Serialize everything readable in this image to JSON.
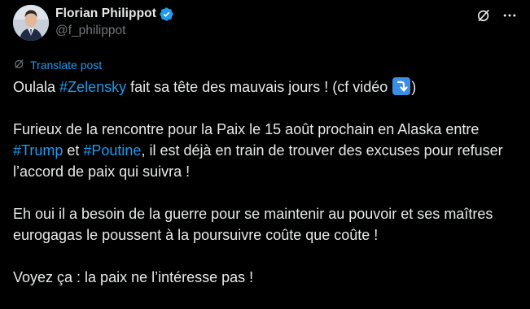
{
  "author": {
    "display_name": "Florian Philippot",
    "handle": "@f_philippot"
  },
  "icons": {
    "verified": "verified-badge-icon",
    "grok": "grok-icon",
    "more": "more-options-icon",
    "translate": "translate-icon",
    "arrow_emoji": "right-arrow-curving-down-icon"
  },
  "colors": {
    "background": "#000000",
    "text": "#e7e9ea",
    "secondary_text": "#71767b",
    "accent": "#1d9bf0"
  },
  "translate_label": "Translate post",
  "post": {
    "p1": {
      "before": "Oulala ",
      "hashtag": "#Zelensky",
      "after": " fait sa tête des mauvais jours ! (cf vidéo ",
      "end": ")"
    },
    "p2": {
      "before": "Furieux de la rencontre pour la Paix le 15 août prochain en Alaska entre ",
      "hashtag1": "#Trump",
      "middle": " et ",
      "hashtag2": "#Poutine",
      "after": ", il est déjà en train de trouver des excuses pour refuser l’accord de paix qui suivra !"
    },
    "p3": "Eh oui il a besoin de la guerre pour se maintenir au pouvoir et ses maîtres eurogagas le poussent à la poursuivre coûte que coûte !",
    "p4": "Voyez ça : la paix ne l’intéresse pas !"
  }
}
